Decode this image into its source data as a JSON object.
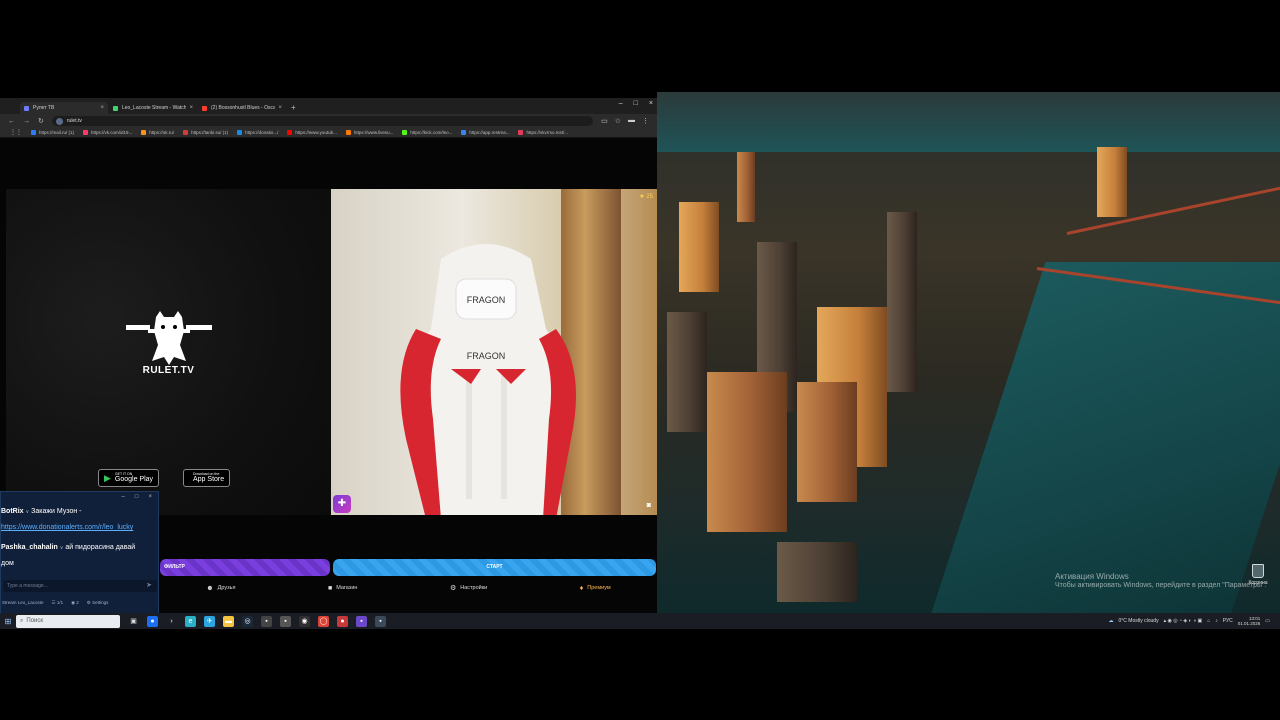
{
  "browser": {
    "tabs": [
      {
        "title": "Рулет ТВ",
        "color": "#6b7cff",
        "active": true
      },
      {
        "title": "Leo_Lacoste Stream - Watch Li...",
        "color": "#44d36b",
        "active": false
      },
      {
        "title": "(2) Bossonhustl Blues - Oscar i...",
        "color": "#ff3b30",
        "active": false
      }
    ],
    "new_tab": "+",
    "url": "rulet.tv",
    "bookmarks": [
      {
        "label": "https://mail.ru/ (1)",
        "color": "#2d7cf6"
      },
      {
        "label": "https://vk.com/id19...",
        "color": "#ff3b6b"
      },
      {
        "label": "https://ok.ru/",
        "color": "#f7931e"
      },
      {
        "label": "https://tanki.su/ (1)",
        "color": "#d13b3b"
      },
      {
        "label": "https://donatio.../",
        "color": "#1e88e5"
      },
      {
        "label": "https://www.youtub...",
        "color": "#ff0000"
      },
      {
        "label": "https://www.livesu...",
        "color": "#ff7a00"
      },
      {
        "label": "https://kick.com/leo...",
        "color": "#53fc18"
      },
      {
        "label": "https://app.restrea...",
        "color": "#3b82f6"
      },
      {
        "label": "https://vkvrrso.mst/...",
        "color": "#e33b5a"
      }
    ]
  },
  "site": {
    "logo_text": "RULET.TV",
    "google_play": {
      "small": "GET IT ON",
      "big": "Google Play"
    },
    "app_store": {
      "small": "Download on the",
      "big": "App Store"
    },
    "video_badge": "25",
    "filter_label": "ФИЛЬТР",
    "start_label": "СТАРТ",
    "nav": [
      {
        "label": "Друзья",
        "icon": "friends-icon"
      },
      {
        "label": "Магазин",
        "icon": "shop-icon"
      },
      {
        "label": "Настройки",
        "icon": "settings-icon"
      },
      {
        "label": "Премиум",
        "icon": "premium-icon"
      }
    ]
  },
  "chat": {
    "messages": [
      {
        "user": "BotRix",
        "text": "Закажи Музон -"
      },
      {
        "link": "https://www.donationalerts.com/r/leo_lucky"
      },
      {
        "user": "Pashka_chahalin",
        "text": "ай пидорасина давай"
      },
      {
        "text": "дом"
      }
    ],
    "input_placeholder": "Type a message...",
    "footer": {
      "channel": "Stream Leo_Lacoste",
      "viewers": "1/1",
      "eye_count": "2",
      "settings": "Settings"
    }
  },
  "desktop": {
    "activate_title": "Активация Windows",
    "activate_text": "Чтобы активировать Windows, перейдите в раздел \"Параметры\".",
    "recycle_label": "Корзина"
  },
  "taskbar": {
    "search_placeholder": "Поиск",
    "weather": "0°C  Mostly cloudy",
    "lang": "РУС",
    "time": "13:01",
    "date": "01.01.2026"
  }
}
